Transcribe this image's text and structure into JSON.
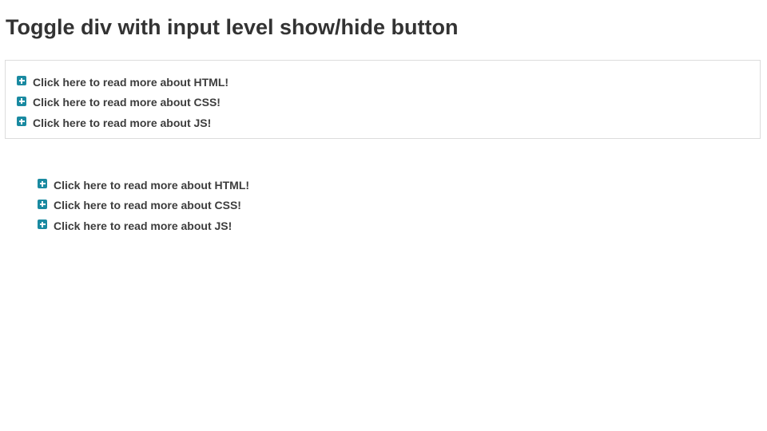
{
  "page": {
    "title": "Toggle div with input level show/hide button"
  },
  "bordered_section": {
    "items": [
      {
        "label": "Click here to read more about HTML!",
        "icon": "plus-square-icon"
      },
      {
        "label": "Click here to read more about CSS!",
        "icon": "plus-square-icon"
      },
      {
        "label": "Click here to read more about JS!",
        "icon": "plus-square-icon"
      }
    ]
  },
  "plain_section": {
    "items": [
      {
        "label": "Click here to read more about HTML!",
        "icon": "plus-square-icon"
      },
      {
        "label": "Click here to read more about CSS!",
        "icon": "plus-square-icon"
      },
      {
        "label": "Click here to read more about JS!",
        "icon": "plus-square-icon"
      }
    ]
  },
  "colors": {
    "icon": "#1a8aa1",
    "text": "#333333",
    "border": "#dcdcdc"
  }
}
